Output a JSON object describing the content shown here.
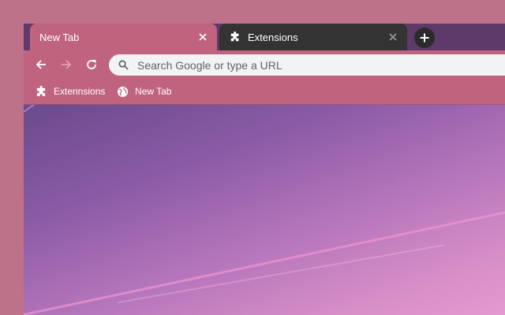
{
  "tabs": [
    {
      "title": "New Tab",
      "active": true
    },
    {
      "title": "Extensions",
      "active": false
    }
  ],
  "omnibox": {
    "placeholder": "Search Google or type a URL",
    "value": ""
  },
  "bookmarks": [
    {
      "label": "Extennsions",
      "icon": "puzzle-icon"
    },
    {
      "label": "New Tab",
      "icon": "globe-icon"
    }
  ],
  "theme": {
    "desktop": "#bd7289",
    "frame": "#5e3a69",
    "toolbar": "#c0637e",
    "inactive_tab": "#333333",
    "omnibox": "#f1f3f4"
  }
}
